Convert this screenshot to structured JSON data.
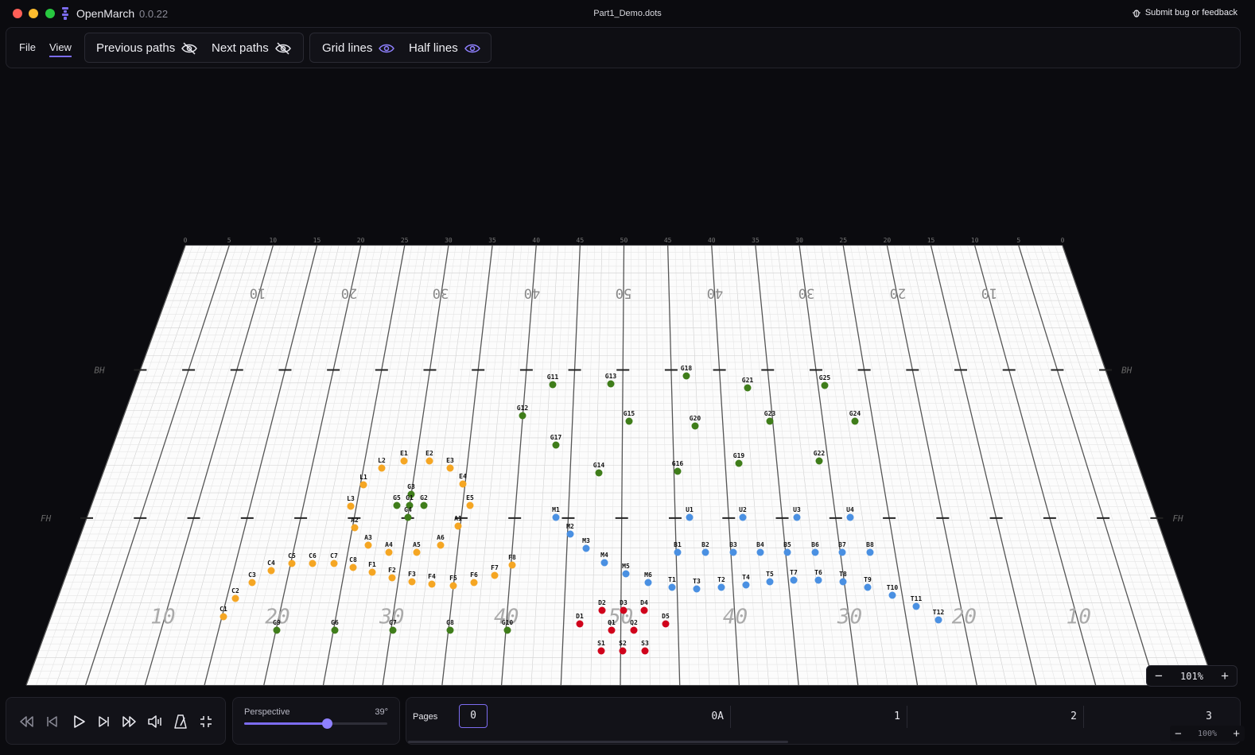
{
  "app": {
    "name": "OpenMarch",
    "version": "0.0.22",
    "file_title": "Part1_Demo.dots",
    "feedback_label": "Submit bug or feedback"
  },
  "menu": {
    "file": "File",
    "view": "View"
  },
  "toggles": {
    "previous_paths": "Previous paths",
    "next_paths": "Next paths",
    "grid_lines": "Grid lines",
    "half_lines": "Half lines"
  },
  "field": {
    "top_numbers": [
      "10",
      "20",
      "30",
      "40",
      "50",
      "40",
      "30",
      "20",
      "10"
    ],
    "bottom_numbers": [
      "10",
      "20",
      "30",
      "40",
      "50",
      "40",
      "30",
      "20",
      "10"
    ],
    "hash_labels": {
      "back": "BH",
      "front": "FH"
    },
    "top_ticks": [
      "0",
      "5",
      "10",
      "15",
      "20",
      "25",
      "30",
      "35",
      "40",
      "45",
      "50",
      "45",
      "40",
      "35",
      "30",
      "25",
      "20",
      "15",
      "10",
      "5",
      "0"
    ],
    "colors": {
      "orange": "#f5a623",
      "green": "#3f7d1a",
      "blue": "#4a90e2",
      "red": "#d0021b"
    },
    "dots": [
      {
        "label": "G11",
        "c": "green"
      },
      {
        "label": "G13",
        "c": "green"
      },
      {
        "label": "G18",
        "c": "green"
      },
      {
        "label": "G21",
        "c": "green"
      },
      {
        "label": "G25",
        "c": "green"
      },
      {
        "label": "G12",
        "c": "green"
      },
      {
        "label": "G15",
        "c": "green"
      },
      {
        "label": "G20",
        "c": "green"
      },
      {
        "label": "G23",
        "c": "green"
      },
      {
        "label": "G24",
        "c": "green"
      },
      {
        "label": "G17",
        "c": "green"
      },
      {
        "label": "G14",
        "c": "green"
      },
      {
        "label": "G16",
        "c": "green"
      },
      {
        "label": "G19",
        "c": "green"
      },
      {
        "label": "G22",
        "c": "green"
      },
      {
        "label": "G3",
        "c": "green"
      },
      {
        "label": "G5",
        "c": "green"
      },
      {
        "label": "G1",
        "c": "green"
      },
      {
        "label": "G2",
        "c": "green"
      },
      {
        "label": "G4",
        "c": "green"
      },
      {
        "label": "G9",
        "c": "green"
      },
      {
        "label": "G6",
        "c": "green"
      },
      {
        "label": "G7",
        "c": "green"
      },
      {
        "label": "G8",
        "c": "green"
      },
      {
        "label": "G10",
        "c": "green"
      },
      {
        "label": "L2",
        "c": "orange"
      },
      {
        "label": "E1",
        "c": "orange"
      },
      {
        "label": "E2",
        "c": "orange"
      },
      {
        "label": "E3",
        "c": "orange"
      },
      {
        "label": "E4",
        "c": "orange"
      },
      {
        "label": "L1",
        "c": "orange"
      },
      {
        "label": "L3",
        "c": "orange"
      },
      {
        "label": "E5",
        "c": "orange"
      },
      {
        "label": "A2",
        "c": "orange"
      },
      {
        "label": "A1",
        "c": "orange"
      },
      {
        "label": "A3",
        "c": "orange"
      },
      {
        "label": "A4",
        "c": "orange"
      },
      {
        "label": "A5",
        "c": "orange"
      },
      {
        "label": "A6",
        "c": "orange"
      },
      {
        "label": "C4",
        "c": "orange"
      },
      {
        "label": "C5",
        "c": "orange"
      },
      {
        "label": "C6",
        "c": "orange"
      },
      {
        "label": "C7",
        "c": "orange"
      },
      {
        "label": "C8",
        "c": "orange"
      },
      {
        "label": "C3",
        "c": "orange"
      },
      {
        "label": "C2",
        "c": "orange"
      },
      {
        "label": "C1",
        "c": "orange"
      },
      {
        "label": "F1",
        "c": "orange"
      },
      {
        "label": "F2",
        "c": "orange"
      },
      {
        "label": "F3",
        "c": "orange"
      },
      {
        "label": "F4",
        "c": "orange"
      },
      {
        "label": "F5",
        "c": "orange"
      },
      {
        "label": "F6",
        "c": "orange"
      },
      {
        "label": "F7",
        "c": "orange"
      },
      {
        "label": "F8",
        "c": "orange"
      },
      {
        "label": "M1",
        "c": "blue"
      },
      {
        "label": "M2",
        "c": "blue"
      },
      {
        "label": "M3",
        "c": "blue"
      },
      {
        "label": "M4",
        "c": "blue"
      },
      {
        "label": "M5",
        "c": "blue"
      },
      {
        "label": "M6",
        "c": "blue"
      },
      {
        "label": "U1",
        "c": "blue"
      },
      {
        "label": "U2",
        "c": "blue"
      },
      {
        "label": "U3",
        "c": "blue"
      },
      {
        "label": "U4",
        "c": "blue"
      },
      {
        "label": "B1",
        "c": "blue"
      },
      {
        "label": "B2",
        "c": "blue"
      },
      {
        "label": "B3",
        "c": "blue"
      },
      {
        "label": "B4",
        "c": "blue"
      },
      {
        "label": "B5",
        "c": "blue"
      },
      {
        "label": "B6",
        "c": "blue"
      },
      {
        "label": "B7",
        "c": "blue"
      },
      {
        "label": "B8",
        "c": "blue"
      },
      {
        "label": "T1",
        "c": "blue"
      },
      {
        "label": "T3",
        "c": "blue"
      },
      {
        "label": "T2",
        "c": "blue"
      },
      {
        "label": "T4",
        "c": "blue"
      },
      {
        "label": "T5",
        "c": "blue"
      },
      {
        "label": "T7",
        "c": "blue"
      },
      {
        "label": "T6",
        "c": "blue"
      },
      {
        "label": "T8",
        "c": "blue"
      },
      {
        "label": "T9",
        "c": "blue"
      },
      {
        "label": "T10",
        "c": "blue"
      },
      {
        "label": "T11",
        "c": "blue"
      },
      {
        "label": "T12",
        "c": "blue"
      },
      {
        "label": "D2",
        "c": "red"
      },
      {
        "label": "D3",
        "c": "red"
      },
      {
        "label": "D4",
        "c": "red"
      },
      {
        "label": "D1",
        "c": "red"
      },
      {
        "label": "D5",
        "c": "red"
      },
      {
        "label": "Q1",
        "c": "red"
      },
      {
        "label": "Q2",
        "c": "red"
      },
      {
        "label": "S1",
        "c": "red"
      },
      {
        "label": "S2",
        "c": "red"
      },
      {
        "label": "S3",
        "c": "red"
      }
    ]
  },
  "zoom": {
    "value": "101%",
    "minus": "−",
    "plus": "+"
  },
  "playback": {
    "buttons": [
      "rewind-icon",
      "skip-back-icon",
      "play-icon",
      "skip-forward-icon",
      "fast-forward-icon",
      "audio-icon",
      "metronome-icon",
      "collapse-icon"
    ]
  },
  "perspective": {
    "label": "Perspective",
    "value": "39°",
    "fraction": 0.58
  },
  "pages": {
    "label": "Pages",
    "items": [
      "0",
      "0A",
      "1",
      "2",
      "3"
    ],
    "zoom": "100%",
    "minus": "−",
    "plus": "+"
  }
}
